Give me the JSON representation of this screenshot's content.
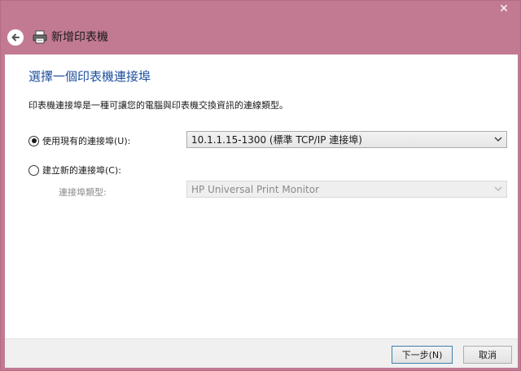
{
  "window": {
    "title": "新增印表機",
    "accent": "#c27a92"
  },
  "page": {
    "heading": "選擇一個印表機連接埠",
    "description": "印表機連接埠是一種可讓您的電腦與印表機交換資訊的連線類型。"
  },
  "options": {
    "existing_label": "使用現有的連接埠(U):",
    "existing_selected": true,
    "existing_value": "10.1.1.15-1300 (標準 TCP/IP 連接埠)",
    "new_label": "建立新的連接埠(C):",
    "new_selected": false,
    "port_type_label": "連接埠類型:",
    "port_type_value": "HP Universal Print Monitor"
  },
  "footer": {
    "next_label": "下一步(N)",
    "cancel_label": "取消"
  },
  "icons": {
    "close": "close-icon",
    "back": "back-arrow-icon",
    "printer": "printer-icon"
  }
}
